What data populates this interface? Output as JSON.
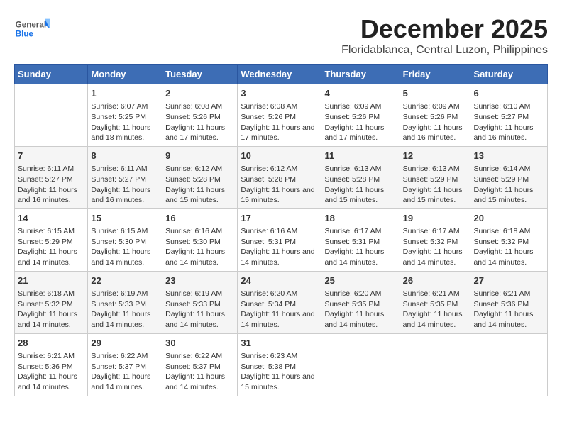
{
  "header": {
    "logo_general": "General",
    "logo_blue": "Blue",
    "title": "December 2025",
    "subtitle": "Floridablanca, Central Luzon, Philippines"
  },
  "columns": [
    "Sunday",
    "Monday",
    "Tuesday",
    "Wednesday",
    "Thursday",
    "Friday",
    "Saturday"
  ],
  "weeks": [
    [
      {
        "day": "",
        "info": ""
      },
      {
        "day": "1",
        "info": "Sunrise: 6:07 AM\nSunset: 5:25 PM\nDaylight: 11 hours and 18 minutes."
      },
      {
        "day": "2",
        "info": "Sunrise: 6:08 AM\nSunset: 5:26 PM\nDaylight: 11 hours and 17 minutes."
      },
      {
        "day": "3",
        "info": "Sunrise: 6:08 AM\nSunset: 5:26 PM\nDaylight: 11 hours and 17 minutes."
      },
      {
        "day": "4",
        "info": "Sunrise: 6:09 AM\nSunset: 5:26 PM\nDaylight: 11 hours and 17 minutes."
      },
      {
        "day": "5",
        "info": "Sunrise: 6:09 AM\nSunset: 5:26 PM\nDaylight: 11 hours and 16 minutes."
      },
      {
        "day": "6",
        "info": "Sunrise: 6:10 AM\nSunset: 5:27 PM\nDaylight: 11 hours and 16 minutes."
      }
    ],
    [
      {
        "day": "7",
        "info": "Sunrise: 6:11 AM\nSunset: 5:27 PM\nDaylight: 11 hours and 16 minutes."
      },
      {
        "day": "8",
        "info": "Sunrise: 6:11 AM\nSunset: 5:27 PM\nDaylight: 11 hours and 16 minutes."
      },
      {
        "day": "9",
        "info": "Sunrise: 6:12 AM\nSunset: 5:28 PM\nDaylight: 11 hours and 15 minutes."
      },
      {
        "day": "10",
        "info": "Sunrise: 6:12 AM\nSunset: 5:28 PM\nDaylight: 11 hours and 15 minutes."
      },
      {
        "day": "11",
        "info": "Sunrise: 6:13 AM\nSunset: 5:28 PM\nDaylight: 11 hours and 15 minutes."
      },
      {
        "day": "12",
        "info": "Sunrise: 6:13 AM\nSunset: 5:29 PM\nDaylight: 11 hours and 15 minutes."
      },
      {
        "day": "13",
        "info": "Sunrise: 6:14 AM\nSunset: 5:29 PM\nDaylight: 11 hours and 15 minutes."
      }
    ],
    [
      {
        "day": "14",
        "info": "Sunrise: 6:15 AM\nSunset: 5:29 PM\nDaylight: 11 hours and 14 minutes."
      },
      {
        "day": "15",
        "info": "Sunrise: 6:15 AM\nSunset: 5:30 PM\nDaylight: 11 hours and 14 minutes."
      },
      {
        "day": "16",
        "info": "Sunrise: 6:16 AM\nSunset: 5:30 PM\nDaylight: 11 hours and 14 minutes."
      },
      {
        "day": "17",
        "info": "Sunrise: 6:16 AM\nSunset: 5:31 PM\nDaylight: 11 hours and 14 minutes."
      },
      {
        "day": "18",
        "info": "Sunrise: 6:17 AM\nSunset: 5:31 PM\nDaylight: 11 hours and 14 minutes."
      },
      {
        "day": "19",
        "info": "Sunrise: 6:17 AM\nSunset: 5:32 PM\nDaylight: 11 hours and 14 minutes."
      },
      {
        "day": "20",
        "info": "Sunrise: 6:18 AM\nSunset: 5:32 PM\nDaylight: 11 hours and 14 minutes."
      }
    ],
    [
      {
        "day": "21",
        "info": "Sunrise: 6:18 AM\nSunset: 5:32 PM\nDaylight: 11 hours and 14 minutes."
      },
      {
        "day": "22",
        "info": "Sunrise: 6:19 AM\nSunset: 5:33 PM\nDaylight: 11 hours and 14 minutes."
      },
      {
        "day": "23",
        "info": "Sunrise: 6:19 AM\nSunset: 5:33 PM\nDaylight: 11 hours and 14 minutes."
      },
      {
        "day": "24",
        "info": "Sunrise: 6:20 AM\nSunset: 5:34 PM\nDaylight: 11 hours and 14 minutes."
      },
      {
        "day": "25",
        "info": "Sunrise: 6:20 AM\nSunset: 5:35 PM\nDaylight: 11 hours and 14 minutes."
      },
      {
        "day": "26",
        "info": "Sunrise: 6:21 AM\nSunset: 5:35 PM\nDaylight: 11 hours and 14 minutes."
      },
      {
        "day": "27",
        "info": "Sunrise: 6:21 AM\nSunset: 5:36 PM\nDaylight: 11 hours and 14 minutes."
      }
    ],
    [
      {
        "day": "28",
        "info": "Sunrise: 6:21 AM\nSunset: 5:36 PM\nDaylight: 11 hours and 14 minutes."
      },
      {
        "day": "29",
        "info": "Sunrise: 6:22 AM\nSunset: 5:37 PM\nDaylight: 11 hours and 14 minutes."
      },
      {
        "day": "30",
        "info": "Sunrise: 6:22 AM\nSunset: 5:37 PM\nDaylight: 11 hours and 14 minutes."
      },
      {
        "day": "31",
        "info": "Sunrise: 6:23 AM\nSunset: 5:38 PM\nDaylight: 11 hours and 15 minutes."
      },
      {
        "day": "",
        "info": ""
      },
      {
        "day": "",
        "info": ""
      },
      {
        "day": "",
        "info": ""
      }
    ]
  ]
}
